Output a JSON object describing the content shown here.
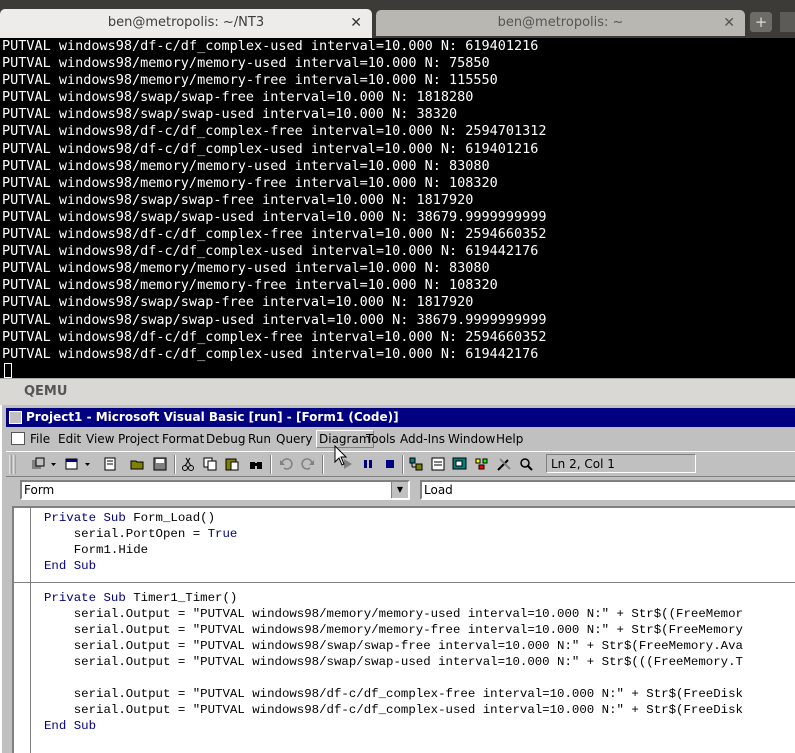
{
  "terminal_tabs": [
    {
      "title": "ben@metropolis: ~/NT3",
      "close": "✕"
    },
    {
      "title": "ben@metropolis: ~",
      "close": "✕"
    }
  ],
  "new_tab_symbol": "+",
  "terminal_lines": [
    "PUTVAL windows98/df-c/df_complex-used interval=10.000 N: 619401216",
    "PUTVAL windows98/memory/memory-used interval=10.000 N: 75850",
    "PUTVAL windows98/memory/memory-free interval=10.000 N: 115550",
    "PUTVAL windows98/swap/swap-free interval=10.000 N: 1818280",
    "PUTVAL windows98/swap/swap-used interval=10.000 N: 38320",
    "PUTVAL windows98/df-c/df_complex-free interval=10.000 N: 2594701312",
    "PUTVAL windows98/df-c/df_complex-used interval=10.000 N: 619401216",
    "PUTVAL windows98/memory/memory-used interval=10.000 N: 83080",
    "PUTVAL windows98/memory/memory-free interval=10.000 N: 108320",
    "PUTVAL windows98/swap/swap-free interval=10.000 N: 1817920",
    "PUTVAL windows98/swap/swap-used interval=10.000 N: 38679.9999999999",
    "PUTVAL windows98/df-c/df_complex-free interval=10.000 N: 2594660352",
    "PUTVAL windows98/df-c/df_complex-used interval=10.000 N: 619442176",
    "PUTVAL windows98/memory/memory-used interval=10.000 N: 83080",
    "PUTVAL windows98/memory/memory-free interval=10.000 N: 108320",
    "PUTVAL windows98/swap/swap-free interval=10.000 N: 1817920",
    "PUTVAL windows98/swap/swap-used interval=10.000 N: 38679.9999999999",
    "PUTVAL windows98/df-c/df_complex-free interval=10.000 N: 2594660352",
    "PUTVAL windows98/df-c/df_complex-used interval=10.000 N: 619442176"
  ],
  "qemu_title": "QEMU",
  "vb": {
    "title": "Project1 - Microsoft Visual Basic [run] - [Form1 (Code)]",
    "menu": [
      "File",
      "Edit",
      "View",
      "Project",
      "Format",
      "Debug",
      "Run",
      "Query",
      "Diagram",
      "Tools",
      "Add-Ins",
      "Window",
      "Help"
    ],
    "hovered_menu": "Diagram",
    "cursor_position": "Ln 2, Col 1",
    "object_combo": "Form",
    "procedure_combo": "Load",
    "code_block_1": [
      [
        {
          "t": "Private Sub ",
          "k": true
        },
        {
          "t": "Form_Load()"
        }
      ],
      [
        {
          "t": "    serial.PortOpen = "
        },
        {
          "t": "True",
          "k": true
        }
      ],
      [
        {
          "t": "    Form1.Hide"
        }
      ],
      [
        {
          "t": "End Sub",
          "k": true
        }
      ]
    ],
    "code_block_2": [
      [
        {
          "t": "Private Sub ",
          "k": true
        },
        {
          "t": "Timer1_Timer()"
        }
      ],
      [
        {
          "t": "    serial.Output = \"PUTVAL windows98/memory/memory-used interval=10.000 N:\" + Str$((FreeMemor"
        }
      ],
      [
        {
          "t": "    serial.Output = \"PUTVAL windows98/memory/memory-free interval=10.000 N:\" + Str$(FreeMemory"
        }
      ],
      [
        {
          "t": "    serial.Output = \"PUTVAL windows98/swap/swap-free interval=10.000 N:\" + Str$(FreeMemory.Ava"
        }
      ],
      [
        {
          "t": "    serial.Output = \"PUTVAL windows98/swap/swap-used interval=10.000 N:\" + Str$(((FreeMemory.T"
        }
      ],
      [
        {
          "t": ""
        }
      ],
      [
        {
          "t": "    serial.Output = \"PUTVAL windows98/df-c/df_complex-free interval=10.000 N:\" + Str$(FreeDisk"
        }
      ],
      [
        {
          "t": "    serial.Output = \"PUTVAL windows98/df-c/df_complex-used interval=10.000 N:\" + Str$(FreeDisk"
        }
      ],
      [
        {
          "t": "End Sub",
          "k": true
        }
      ]
    ]
  }
}
